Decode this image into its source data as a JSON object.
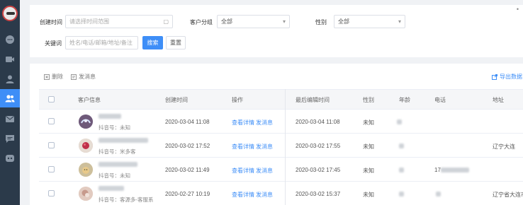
{
  "sidebar": {
    "items": [
      {
        "icon": "chat-bubble-icon",
        "active": false
      },
      {
        "icon": "video-icon",
        "active": false
      },
      {
        "icon": "user-icon",
        "active": false
      },
      {
        "icon": "customers-icon",
        "active": true
      },
      {
        "icon": "mail-icon",
        "active": false
      },
      {
        "icon": "message-icon",
        "active": false
      },
      {
        "icon": "robot-chat-icon",
        "active": false
      }
    ]
  },
  "filters": {
    "created_time_label": "创建时间",
    "created_time_placeholder": "请选择时间范围",
    "customer_group_label": "客户分组",
    "customer_group_value": "全部",
    "gender_label": "性别",
    "gender_value": "全部",
    "keyword_label": "关键词",
    "keyword_placeholder": "姓名/电话/邮箱/地址/备注",
    "search_button": "搜索",
    "reset_button": "重置"
  },
  "toolbar": {
    "delete_label": "删除",
    "send_message_label": "发消息",
    "export_label": "导出数据"
  },
  "table": {
    "headers": {
      "customer_info": "客户信息",
      "created_time": "创建时间",
      "operation": "操作",
      "last_edit_time": "最后编辑时间",
      "gender": "性别",
      "age": "年龄",
      "phone": "电话",
      "address": "地址"
    },
    "view_detail_label": "查看详情",
    "send_message_label": "发消息",
    "rows": [
      {
        "douyin_id": "抖音号：未知",
        "created": "2020-03-04 11:08",
        "last_edit": "2020-03-04 11:08",
        "gender": "未知",
        "phone": "",
        "address": ""
      },
      {
        "douyin_id": "抖音号：米多客",
        "created": "2020-03-02 17:52",
        "last_edit": "2020-03-02 17:55",
        "gender": "未知",
        "phone": "",
        "address": "辽宁大连"
      },
      {
        "douyin_id": "抖音号：未知",
        "created": "2020-03-02 11:49",
        "last_edit": "2020-03-02 17:45",
        "gender": "未知",
        "phone": "17",
        "address": ""
      },
      {
        "douyin_id": "抖音号：客源多-客服系",
        "created": "2020-02-27 10:19",
        "last_edit": "2020-03-02 15:37",
        "gender": "未知",
        "phone": "",
        "address": "辽宁省大连市"
      }
    ]
  }
}
